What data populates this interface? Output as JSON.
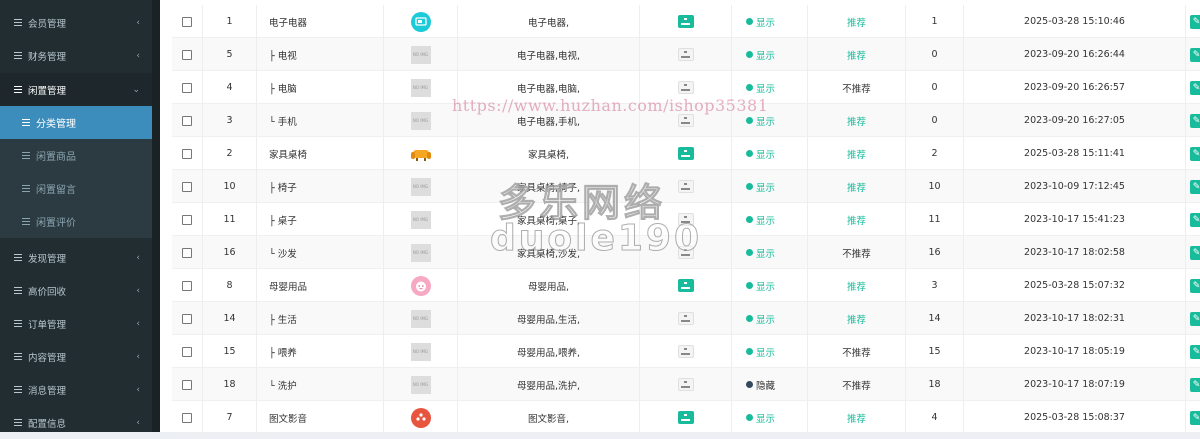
{
  "sidebar": {
    "items": [
      {
        "label": "会员管理",
        "arrow": "‹",
        "state": "collapsed"
      },
      {
        "label": "财务管理",
        "arrow": "‹",
        "state": "collapsed"
      },
      {
        "label": "闲置管理",
        "arrow": "⌄",
        "state": "open"
      },
      {
        "label": "发现管理",
        "arrow": "‹",
        "state": "collapsed"
      },
      {
        "label": "高价回收",
        "arrow": "‹",
        "state": "collapsed"
      },
      {
        "label": "订单管理",
        "arrow": "‹",
        "state": "collapsed"
      },
      {
        "label": "内容管理",
        "arrow": "‹",
        "state": "collapsed"
      },
      {
        "label": "消息管理",
        "arrow": "‹",
        "state": "collapsed"
      },
      {
        "label": "配置信息",
        "arrow": "‹",
        "state": "collapsed"
      }
    ],
    "sub_items": [
      {
        "label": "分类管理",
        "active": true
      },
      {
        "label": "闲置商品",
        "active": false
      },
      {
        "label": "闲置留言",
        "active": false
      },
      {
        "label": "闲置评价",
        "active": false
      }
    ]
  },
  "table": {
    "rows": [
      {
        "id": "1",
        "name": "电子电器",
        "icon": "tv-icon",
        "path": "电子电器,",
        "tree_primary": true,
        "status": "显示",
        "status_on": true,
        "recommend": "推荐",
        "rec_yes": true,
        "order": "1",
        "date": "2025-03-28 15:10:46"
      },
      {
        "id": "5",
        "name": "├ 电视",
        "icon": "placeholder",
        "path": "电子电器,电视,",
        "tree_primary": false,
        "status": "显示",
        "status_on": true,
        "recommend": "推荐",
        "rec_yes": true,
        "order": "0",
        "date": "2023-09-20 16:26:44"
      },
      {
        "id": "4",
        "name": "├ 电脑",
        "icon": "placeholder",
        "path": "电子电器,电脑,",
        "tree_primary": false,
        "status": "显示",
        "status_on": true,
        "recommend": "不推荐",
        "rec_yes": false,
        "order": "0",
        "date": "2023-09-20 16:26:57"
      },
      {
        "id": "3",
        "name": "└ 手机",
        "icon": "placeholder",
        "path": "电子电器,手机,",
        "tree_primary": false,
        "status": "显示",
        "status_on": true,
        "recommend": "推荐",
        "rec_yes": true,
        "order": "0",
        "date": "2023-09-20 16:27:05"
      },
      {
        "id": "2",
        "name": "家具桌椅",
        "icon": "sofa-icon",
        "path": "家具桌椅,",
        "tree_primary": true,
        "status": "显示",
        "status_on": true,
        "recommend": "推荐",
        "rec_yes": true,
        "order": "2",
        "date": "2025-03-28 15:11:41"
      },
      {
        "id": "10",
        "name": "├ 椅子",
        "icon": "placeholder",
        "path": "家具桌椅,椅子,",
        "tree_primary": false,
        "status": "显示",
        "status_on": true,
        "recommend": "推荐",
        "rec_yes": true,
        "order": "10",
        "date": "2023-10-09 17:12:45"
      },
      {
        "id": "11",
        "name": "├ 桌子",
        "icon": "placeholder",
        "path": "家具桌椅,桌子,",
        "tree_primary": false,
        "status": "显示",
        "status_on": true,
        "recommend": "推荐",
        "rec_yes": true,
        "order": "11",
        "date": "2023-10-17 15:41:23"
      },
      {
        "id": "16",
        "name": "└ 沙发",
        "icon": "placeholder",
        "path": "家具桌椅,沙发,",
        "tree_primary": false,
        "status": "显示",
        "status_on": true,
        "recommend": "不推荐",
        "rec_yes": false,
        "order": "16",
        "date": "2023-10-17 18:02:58"
      },
      {
        "id": "8",
        "name": "母婴用品",
        "icon": "baby-icon",
        "path": "母婴用品,",
        "tree_primary": true,
        "status": "显示",
        "status_on": true,
        "recommend": "推荐",
        "rec_yes": true,
        "order": "3",
        "date": "2025-03-28 15:07:32"
      },
      {
        "id": "14",
        "name": "├ 生活",
        "icon": "placeholder",
        "path": "母婴用品,生活,",
        "tree_primary": false,
        "status": "显示",
        "status_on": true,
        "recommend": "推荐",
        "rec_yes": true,
        "order": "14",
        "date": "2023-10-17 18:02:31"
      },
      {
        "id": "15",
        "name": "├ 喂养",
        "icon": "placeholder",
        "path": "母婴用品,喂养,",
        "tree_primary": false,
        "status": "显示",
        "status_on": true,
        "recommend": "不推荐",
        "rec_yes": false,
        "order": "15",
        "date": "2023-10-17 18:05:19"
      },
      {
        "id": "18",
        "name": "└ 洗护",
        "icon": "placeholder",
        "path": "母婴用品,洗护,",
        "tree_primary": false,
        "status": "隐藏",
        "status_on": false,
        "recommend": "不推荐",
        "rec_yes": false,
        "order": "18",
        "date": "2023-10-17 18:07:19"
      },
      {
        "id": "7",
        "name": "图文影音",
        "icon": "film-icon",
        "path": "图文影音,",
        "tree_primary": true,
        "status": "显示",
        "status_on": true,
        "recommend": "推荐",
        "rec_yes": true,
        "order": "4",
        "date": "2025-03-28 15:08:37"
      }
    ],
    "placeholder_text": "NO IMG"
  },
  "watermark": {
    "url": "https://www.huzhan.com/ishop35381",
    "cn": "多乐网络",
    "en": "duole190"
  },
  "colors": {
    "accent": "#18bc9c",
    "danger": "#e74c3c",
    "sidebar": "#222d32",
    "active": "#3c8dbc"
  }
}
